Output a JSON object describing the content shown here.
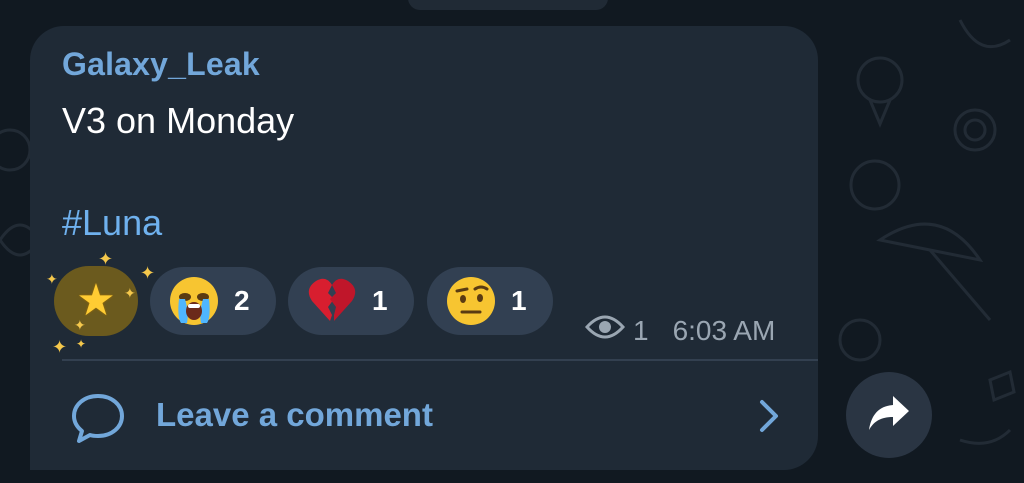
{
  "message": {
    "author": "Galaxy_Leak",
    "text": "V3 on Monday",
    "hashtag": "#Luna",
    "time": "6:03 AM",
    "views": "1"
  },
  "reactions": [
    {
      "icon": "star-icon",
      "count": "",
      "selected": true
    },
    {
      "icon": "crying-face-icon",
      "count": "2"
    },
    {
      "icon": "broken-heart-icon",
      "count": "1"
    },
    {
      "icon": "raised-eyebrow-face-icon",
      "count": "1"
    }
  ],
  "comments": {
    "label": "Leave a comment"
  },
  "colors": {
    "bubble": "#1f2a36",
    "accent": "#72a7da",
    "hashtag": "#6fb1ee",
    "reaction_bg": "#324052",
    "selected_reaction_bg": "#6b5a1e",
    "meta": "#9aa6b2"
  }
}
